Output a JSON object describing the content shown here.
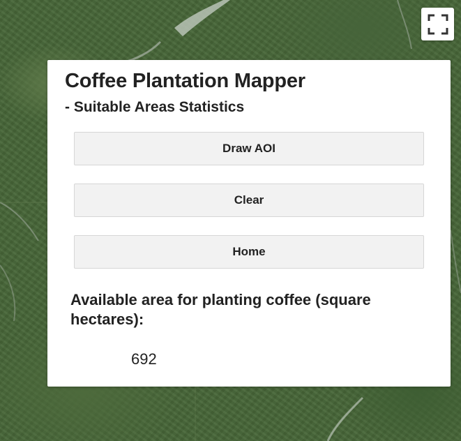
{
  "map": {
    "background": "satellite-imagery",
    "fullscreen_icon": "fullscreen-icon"
  },
  "panel": {
    "title": "Coffee Plantation Mapper",
    "subtitle": "- Suitable Areas Statistics",
    "buttons": {
      "draw": "Draw AOI",
      "clear": "Clear",
      "home": "Home"
    },
    "stat_label": "Available area for planting coffee (square hectares):",
    "stat_value": "692"
  },
  "colors": {
    "panel_bg": "#ffffff",
    "button_bg": "#f2f2f2",
    "text": "#222222"
  }
}
